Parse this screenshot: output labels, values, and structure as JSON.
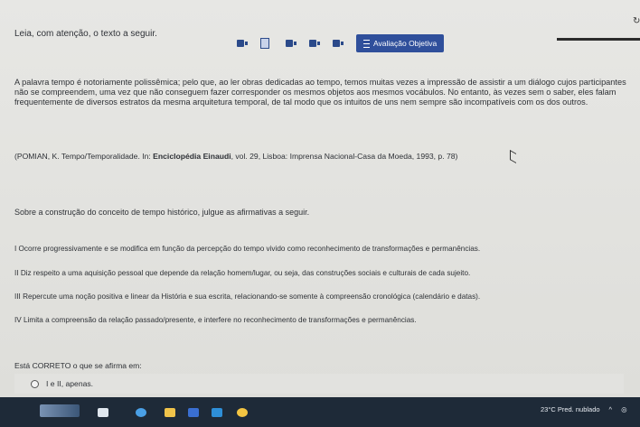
{
  "header": {
    "intro": "Leia, com atenção, o texto a seguir.",
    "active_tab": "Avaliação Objetiva"
  },
  "content": {
    "paragraph": "A palavra tempo é notoriamente polissêmica; pelo que, ao ler obras dedicadas ao tempo, temos muitas vezes a impressão de assistir a um diálogo cujos participantes não se compreendem, uma vez que não conseguem fazer corresponder os mesmos objetos aos mesmos vocábulos. No entanto, às vezes sem o saber, eles falam frequentemente de diversos estratos da mesma arquitetura temporal, de tal modo que os intuitos de uns nem sempre são incompatíveis com os dos outros.",
    "citation_prefix": "(POMIAN, K. Tempo/Temporalidade. In: ",
    "citation_bold": "Enciclopédia Einaudi",
    "citation_suffix": ", vol. 29, Lisboa: Imprensa Nacional-Casa da Moeda, 1993, p. 78)",
    "prompt": "Sobre a construção do conceito de tempo histórico, julgue as afirmativas a seguir.",
    "items": [
      "I Ocorre progressivamente e se modifica em função da percepção do tempo vivido como reconhecimento de transformações e permanências.",
      "II Diz respeito a uma aquisição pessoal que depende da relação homem/lugar, ou seja, das construções sociais e culturais de cada sujeito.",
      "III Repercute uma noção positiva e linear da História e sua escrita, relacionando-se somente à compreensão cronológica (calendário e datas).",
      "IV Limita a compreensão da relação passado/presente, e interfere no reconhecimento de transformações e permanências."
    ],
    "question": "Está CORRETO o que se afirma em:",
    "option_a": "I e II, apenas."
  },
  "taskbar": {
    "weather": "23°C  Pred. nublado"
  },
  "colors": {
    "accent": "#2f4f9b",
    "taskbar": "#1e2a38"
  }
}
